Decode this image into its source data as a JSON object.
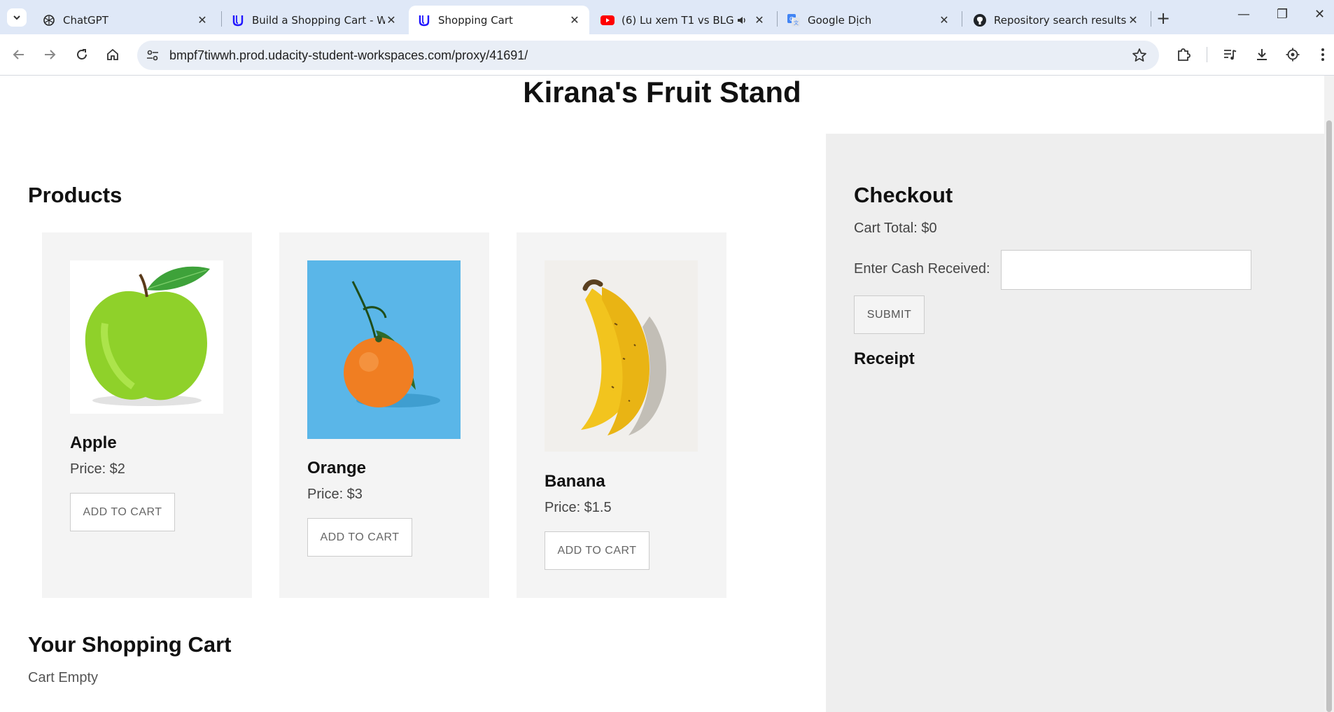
{
  "browser": {
    "tabs": [
      {
        "title": "ChatGPT",
        "icon": "chatgpt-icon"
      },
      {
        "title": "Build a Shopping Cart - Wo",
        "icon": "udacity-icon"
      },
      {
        "title": "Shopping Cart",
        "icon": "udacity-icon",
        "active": true
      },
      {
        "title": "(6) Lu xem T1 vs BLG (B",
        "icon": "youtube-icon"
      },
      {
        "title": "Google Dịch",
        "icon": "google-translate-icon"
      },
      {
        "title": "Repository search results",
        "icon": "github-icon"
      }
    ],
    "url": "bmpf7tiwwh.prod.udacity-student-workspaces.com/proxy/41691/"
  },
  "page": {
    "title": "Kirana's Fruit Stand",
    "products_heading": "Products",
    "add_label": "ADD TO CART",
    "products": [
      {
        "name": "Apple",
        "price": "Price: $2"
      },
      {
        "name": "Orange",
        "price": "Price: $3"
      },
      {
        "name": "Banana",
        "price": "Price: $1.5"
      }
    ],
    "cart_heading": "Your Shopping Cart",
    "cart_empty": "Cart Empty",
    "checkout": {
      "heading": "Checkout",
      "total": "Cart Total: $0",
      "cash_label": "Enter Cash Received:",
      "cash_value": "",
      "submit": "SUBMIT",
      "receipt_heading": "Receipt"
    }
  },
  "colors": {
    "tabbar": "#dfe8f7",
    "card_bg": "#f4f4f4",
    "checkout_bg": "#eeeeee",
    "orange_bg": "#5ab6e8"
  }
}
